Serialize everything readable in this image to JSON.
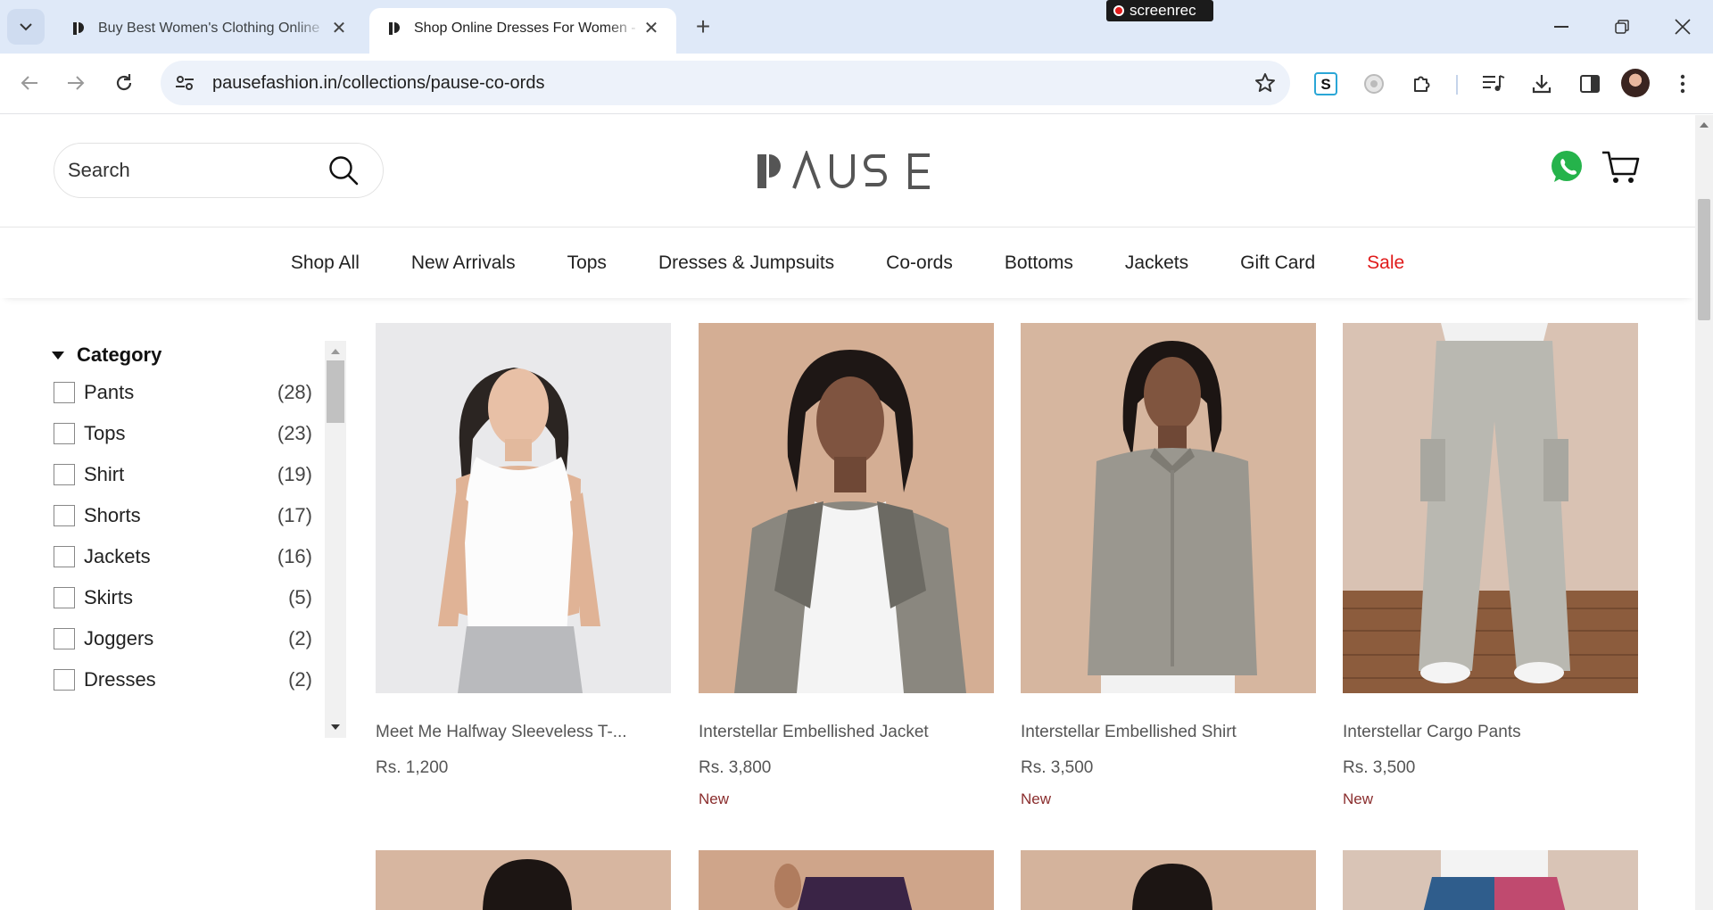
{
  "browser": {
    "tabs": [
      {
        "title": "Buy Best Women's Clothing Online",
        "active": false
      },
      {
        "title": "Shop Online Dresses For Women -",
        "active": true
      }
    ],
    "recorder_label": "screenrec",
    "url": "pausefashion.in/collections/pause-co-ords"
  },
  "header": {
    "search_placeholder": "Search",
    "logo_text": "PAUSE"
  },
  "nav": [
    "Shop All",
    "New Arrivals",
    "Tops",
    "Dresses & Jumpsuits",
    "Co-ords",
    "Bottoms",
    "Jackets",
    "Gift Card",
    "Sale"
  ],
  "filters": {
    "title": "Category",
    "items": [
      {
        "label": "Pants",
        "count": "(28)"
      },
      {
        "label": "Tops",
        "count": "(23)"
      },
      {
        "label": "Shirt",
        "count": "(19)"
      },
      {
        "label": "Shorts",
        "count": "(17)"
      },
      {
        "label": "Jackets",
        "count": "(16)"
      },
      {
        "label": "Skirts",
        "count": "(5)"
      },
      {
        "label": "Joggers",
        "count": "(2)"
      },
      {
        "label": "Dresses",
        "count": "(2)"
      }
    ]
  },
  "products": [
    {
      "name": "Meet Me Halfway Sleeveless T-...",
      "price": "Rs. 1,200",
      "badge": ""
    },
    {
      "name": "Interstellar Embellished Jacket",
      "price": "Rs. 3,800",
      "badge": "New"
    },
    {
      "name": "Interstellar Embellished Shirt",
      "price": "Rs. 3,500",
      "badge": "New"
    },
    {
      "name": "Interstellar Cargo Pants",
      "price": "Rs. 3,500",
      "badge": "New"
    }
  ],
  "colors": {
    "tabstrip": "#dfe9f8",
    "sale": "#e01b1b",
    "badge": "#8a2d2d",
    "whatsapp": "#25b34b"
  }
}
